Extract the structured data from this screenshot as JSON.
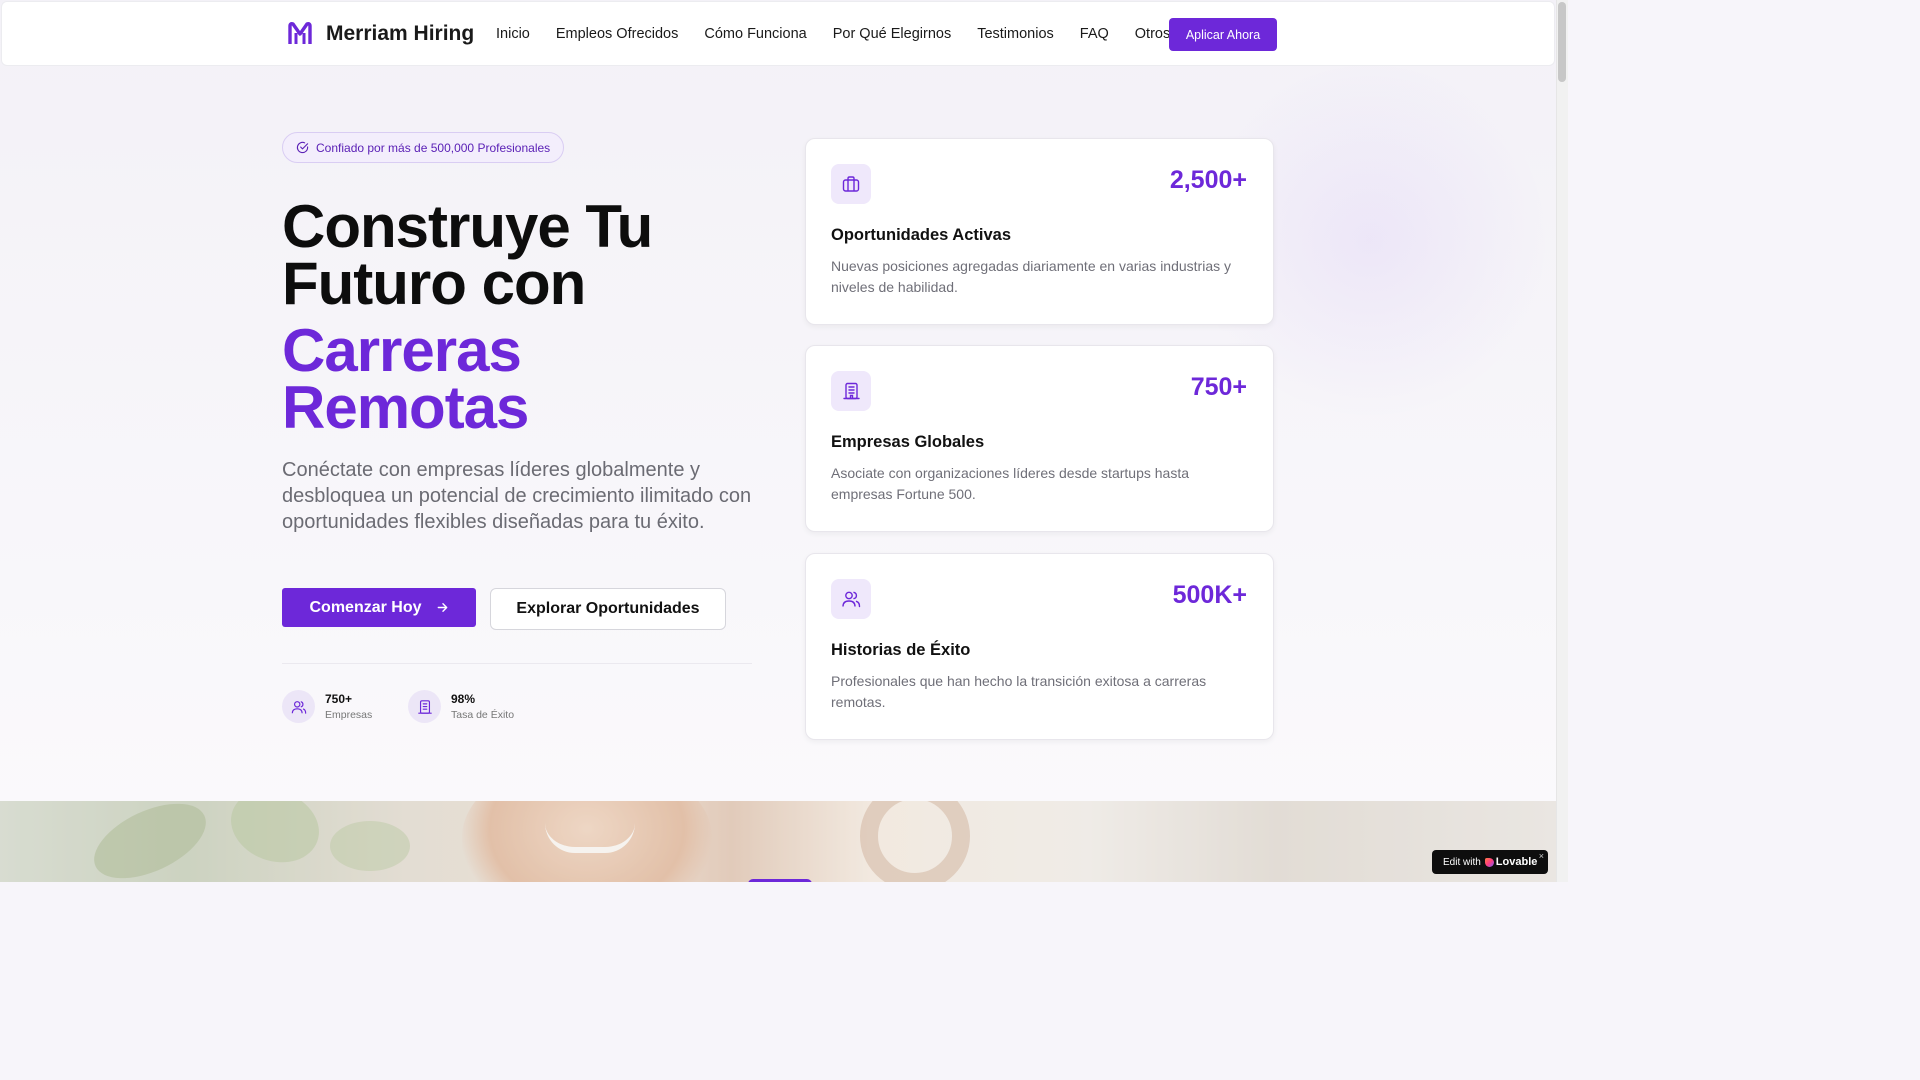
{
  "brand": {
    "name": "Merriam Hiring",
    "accent": "#6d28d9"
  },
  "nav": {
    "items": [
      "Inicio",
      "Empleos Ofrecidos",
      "Cómo Funciona",
      "Por Qué Elegirnos",
      "Testimonios",
      "FAQ",
      "Otros"
    ],
    "cta": "Aplicar Ahora"
  },
  "hero": {
    "badge": "Confiado por más de 500,000 Profesionales",
    "title_line1": "Construye Tu",
    "title_line2": "Futuro con",
    "accent_line1": "Carreras",
    "accent_line2": "Remotas",
    "lead": "Conéctate con empresas líderes globalmente y desbloquea un potencial de crecimiento ilimitado con oportunidades flexibles diseñadas para tu éxito.",
    "primary_button": "Comenzar Hoy",
    "secondary_button": "Explorar Oportunidades",
    "stats": [
      {
        "value": "750+",
        "label": "Empresas",
        "icon": "users-icon"
      },
      {
        "value": "98%",
        "label": "Tasa de Éxito",
        "icon": "building-icon"
      }
    ]
  },
  "cards": [
    {
      "value": "2,500+",
      "title": "Oportunidades Activas",
      "description": "Nuevas posiciones agregadas diariamente en varias industrias y niveles de habilidad.",
      "icon": "briefcase-icon"
    },
    {
      "value": "750+",
      "title": "Empresas Globales",
      "description": "Asociate con organizaciones líderes desde startups hasta empresas Fortune 500.",
      "icon": "building-icon"
    },
    {
      "value": "500K+",
      "title": "Historias de Éxito",
      "description": "Profesionales que han hecho la transición exitosa a carreras remotas.",
      "icon": "users-icon"
    }
  ],
  "lovable_badge": {
    "prefix": "Edit with",
    "brand": "Lovable",
    "close": "×"
  }
}
